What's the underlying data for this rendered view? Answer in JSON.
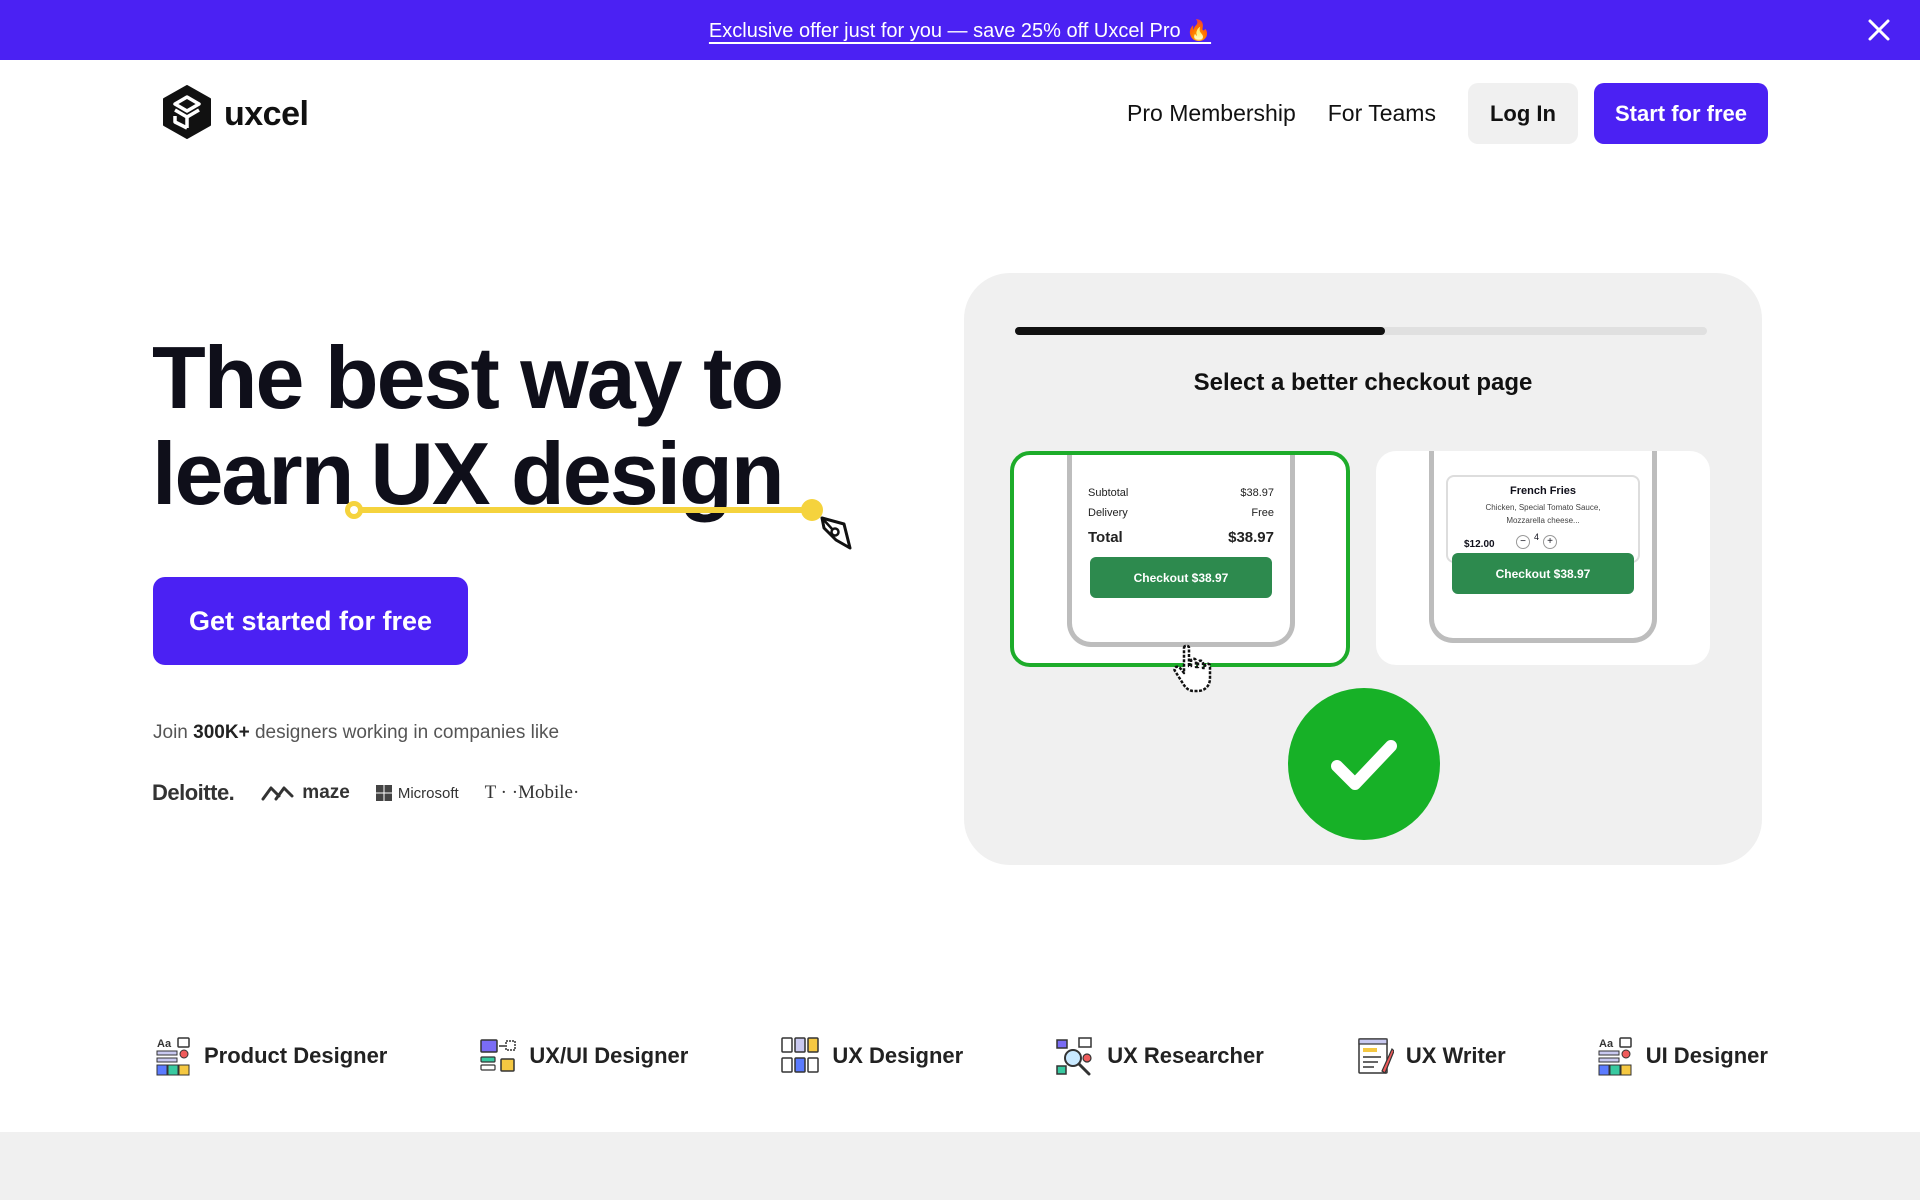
{
  "promo": {
    "text": "Exclusive offer just for you — save 25% off Uxcel Pro 🔥"
  },
  "header": {
    "logo_text": "uxcel",
    "nav": [
      {
        "label": "Pro Membership"
      },
      {
        "label": "For Teams"
      }
    ],
    "login_label": "Log In",
    "start_label": "Start for free"
  },
  "hero": {
    "title_line1": "The best way to",
    "title_line2_plain": "learn",
    "title_line2_highlight": "UX design",
    "cta_label": "Get started for free",
    "join_prefix": "Join",
    "join_count": "300K+",
    "join_suffix": "designers working in companies like",
    "companies": [
      "Deloitte.",
      "maze",
      "Microsoft",
      "T · ·Mobile·"
    ]
  },
  "quiz": {
    "question": "Select a better checkout page",
    "progress": 0.535,
    "option_a": {
      "subtotal_label": "Subtotal",
      "subtotal_value": "$38.97",
      "delivery_label": "Delivery",
      "delivery_value": "Free",
      "total_label": "Total",
      "total_value": "$38.97",
      "button": "Checkout $38.97",
      "selected": true
    },
    "option_b": {
      "item_title": "French Fries",
      "item_desc": "Chicken, Special Tomato Sauce, Mozzarella cheese...",
      "item_price": "$12.00",
      "quantity": "4",
      "button": "Checkout $38.97"
    },
    "accent_colors": {
      "correct": "#17b127",
      "checkout": "#2d8a4e"
    }
  },
  "roles": [
    {
      "label": "Product Designer"
    },
    {
      "label": "UX/UI Designer"
    },
    {
      "label": "UX Designer"
    },
    {
      "label": "UX Researcher"
    },
    {
      "label": "UX Writer"
    },
    {
      "label": "UI Designer"
    }
  ],
  "colors": {
    "brand": "#4b21f3",
    "highlight": "#f5d33d"
  }
}
